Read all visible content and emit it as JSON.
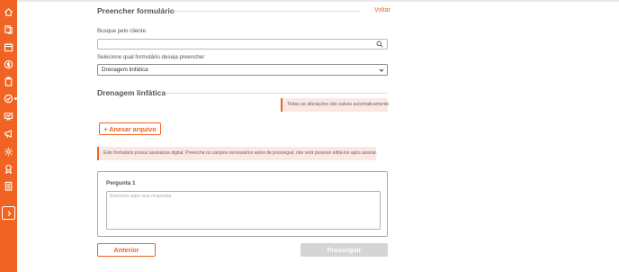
{
  "colors": {
    "accent": "#f06322",
    "notice_bg": "#fbe8e2",
    "disabled_bg": "#d5d5d5"
  },
  "sidebar": {
    "items": [
      {
        "icon": "home-icon"
      },
      {
        "icon": "documents-icon"
      },
      {
        "icon": "calendar-icon"
      },
      {
        "icon": "money-icon"
      },
      {
        "icon": "clipboard-icon"
      },
      {
        "icon": "check-circle-icon",
        "active": true
      },
      {
        "icon": "presentation-icon"
      },
      {
        "icon": "megaphone-icon"
      },
      {
        "icon": "gear-icon"
      },
      {
        "icon": "badge-icon"
      },
      {
        "icon": "checklist-icon"
      }
    ],
    "toggle_icon": "chevron-right-icon"
  },
  "header": {
    "title": "Preencher formulário",
    "back_label": "Voltar"
  },
  "search": {
    "label": "Busque pelo cliente",
    "value": "",
    "placeholder": ""
  },
  "form_select": {
    "label": "Selecione qual formulário deseja preencher",
    "selected": "Drenagem linfática"
  },
  "section": {
    "title": "Drenagem linfática",
    "autosave_notice": "Todas as alterações são salvas automaticamente"
  },
  "attach": {
    "label": "+ Anexar arquivo"
  },
  "signature_notice": "Este formulário possui assinatura digital. Preencha os campos necessários antes de prosseguir, não será possível editá-los após assinar.",
  "question": {
    "label": "Pergunta 1",
    "placeholder": "Escreva aqui sua resposta",
    "value": ""
  },
  "footer": {
    "prev_label": "Anterior",
    "next_label": "Prosseguir"
  }
}
